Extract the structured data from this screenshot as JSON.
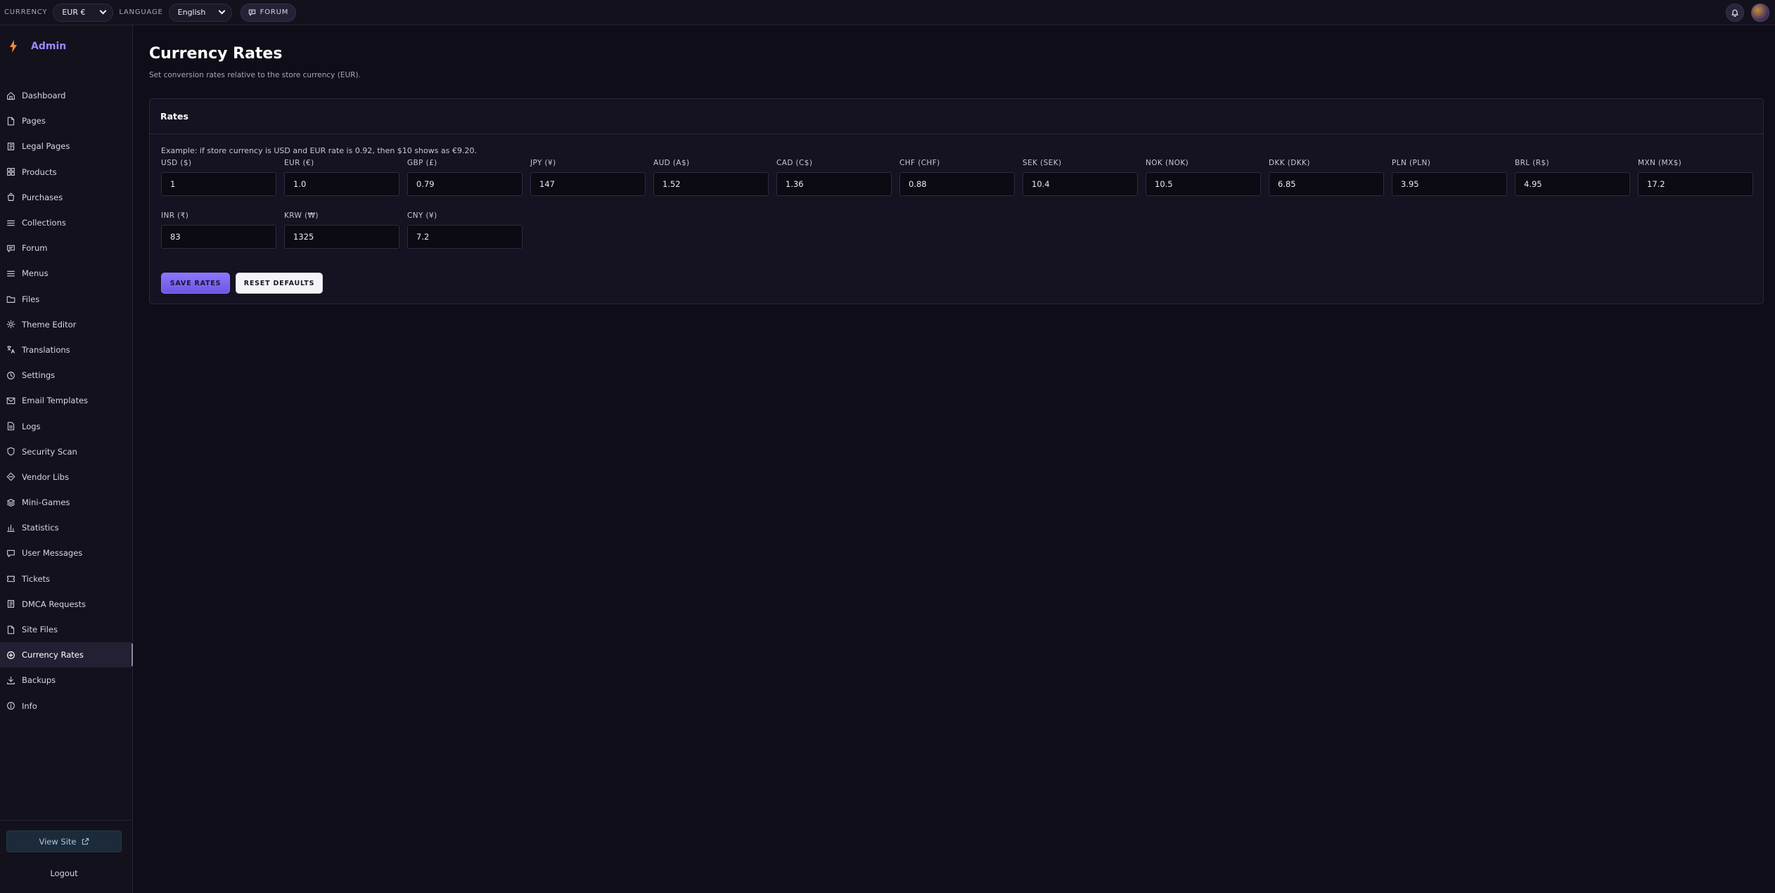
{
  "topbar": {
    "currency_label": "CURRENCY",
    "currency_value": "EUR €",
    "language_label": "LANGUAGE",
    "language_value": "English",
    "forum_label": "FORUM"
  },
  "brand": {
    "label": "Admin",
    "accent": "#9d86ff",
    "icon": "bolt-icon"
  },
  "sidebar": {
    "items": [
      {
        "label": "Dashboard",
        "icon": "home-icon"
      },
      {
        "label": "Pages",
        "icon": "file-icon"
      },
      {
        "label": "Legal Pages",
        "icon": "book-icon"
      },
      {
        "label": "Products",
        "icon": "grid-icon"
      },
      {
        "label": "Purchases",
        "icon": "bag-icon"
      },
      {
        "label": "Collections",
        "icon": "list-icon"
      },
      {
        "label": "Forum",
        "icon": "chat-icon"
      },
      {
        "label": "Menus",
        "icon": "menu-icon"
      },
      {
        "label": "Files",
        "icon": "folder-icon"
      },
      {
        "label": "Theme Editor",
        "icon": "gear-icon"
      },
      {
        "label": "Translations",
        "icon": "translate-icon"
      },
      {
        "label": "Settings",
        "icon": "clock-icon"
      },
      {
        "label": "Email Templates",
        "icon": "mail-icon"
      },
      {
        "label": "Logs",
        "icon": "document-icon"
      },
      {
        "label": "Security Scan",
        "icon": "shield-icon"
      },
      {
        "label": "Vendor Libs",
        "icon": "diamond-icon"
      },
      {
        "label": "Mini-Games",
        "icon": "layers-icon"
      },
      {
        "label": "Statistics",
        "icon": "bar-chart-icon"
      },
      {
        "label": "User Messages",
        "icon": "message-icon"
      },
      {
        "label": "Tickets",
        "icon": "ticket-icon"
      },
      {
        "label": "DMCA Requests",
        "icon": "book-icon"
      },
      {
        "label": "Site Files",
        "icon": "file-icon"
      },
      {
        "label": "Currency Rates",
        "icon": "currency-icon",
        "active": true
      },
      {
        "label": "Backups",
        "icon": "download-icon"
      },
      {
        "label": "Info",
        "icon": "info-icon"
      }
    ],
    "view_site": "View Site",
    "logout": "Logout"
  },
  "main": {
    "title": "Currency Rates",
    "subtitle": "Set conversion rates relative to the store currency (EUR).",
    "card": {
      "title": "Rates",
      "note": "Example: if store currency is USD and EUR rate is 0.92, then $10 shows as €9.20.",
      "rates": [
        {
          "label": "USD ($)",
          "value": "1"
        },
        {
          "label": "EUR (€)",
          "value": "1.0"
        },
        {
          "label": "GBP (£)",
          "value": "0.79"
        },
        {
          "label": "JPY (¥)",
          "value": "147"
        },
        {
          "label": "AUD (A$)",
          "value": "1.52"
        },
        {
          "label": "CAD (C$)",
          "value": "1.36"
        },
        {
          "label": "CHF (CHF)",
          "value": "0.88"
        },
        {
          "label": "SEK (SEK)",
          "value": "10.4"
        },
        {
          "label": "NOK (NOK)",
          "value": "10.5"
        },
        {
          "label": "DKK (DKK)",
          "value": "6.85"
        },
        {
          "label": "PLN (PLN)",
          "value": "3.95"
        },
        {
          "label": "BRL (R$)",
          "value": "4.95"
        },
        {
          "label": "MXN (MX$)",
          "value": "17.2"
        },
        {
          "label": "INR (₹)",
          "value": "83"
        },
        {
          "label": "KRW (₩)",
          "value": "1325"
        },
        {
          "label": "CNY (¥)",
          "value": "7.2"
        }
      ],
      "save_label": "SAVE RATES",
      "reset_label": "RESET DEFAULTS"
    }
  }
}
